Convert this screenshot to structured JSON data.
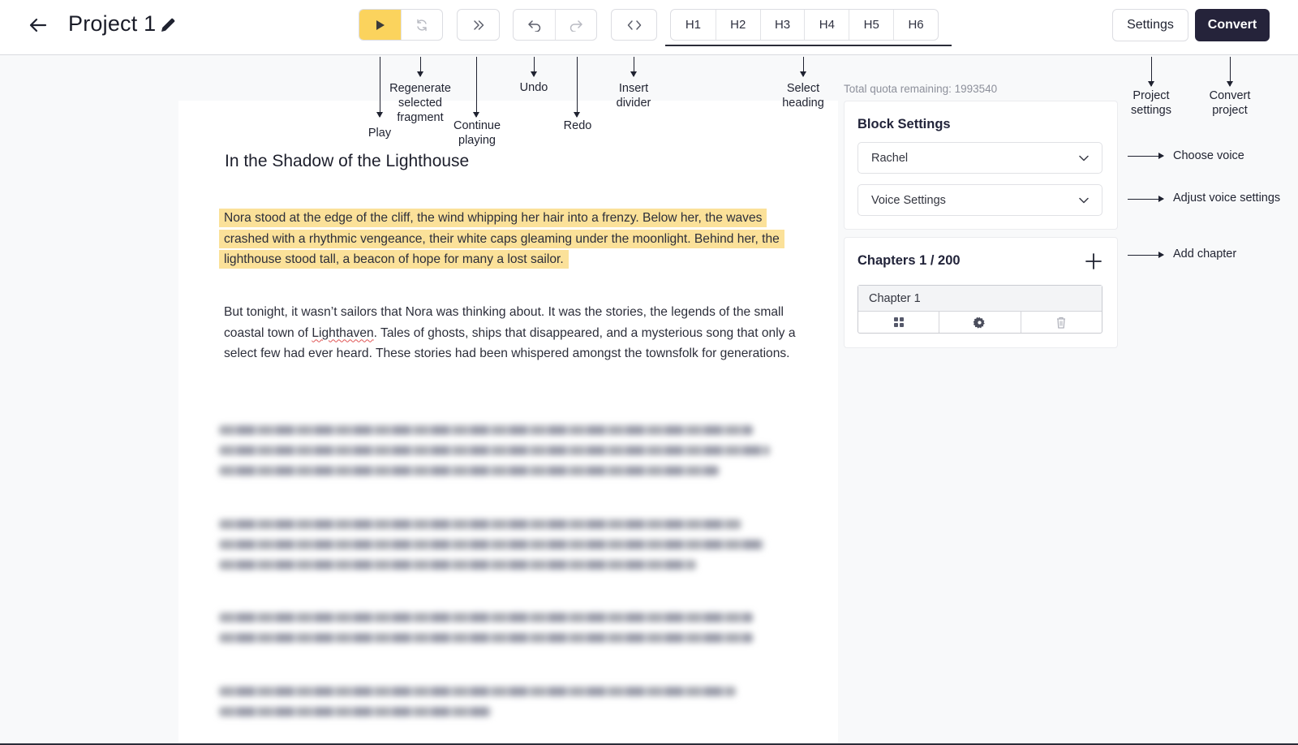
{
  "header": {
    "title": "Project 1",
    "settings_label": "Settings",
    "convert_label": "Convert",
    "headings": [
      "H1",
      "H2",
      "H3",
      "H4",
      "H5",
      "H6"
    ]
  },
  "annotations": {
    "play": "Play",
    "regenerate": "Regenerate selected fragment",
    "continue": "Continue playing",
    "undo": "Undo",
    "redo": "Redo",
    "insert_divider": "Insert divider",
    "select_heading": "Select heading",
    "project_settings": "Project settings",
    "convert_project": "Convert project",
    "choose_voice": "Choose voice",
    "adjust_voice": "Adjust voice settings",
    "add_chapter": "Add chapter"
  },
  "editor": {
    "title": "In the Shadow of the Lighthouse",
    "paragraph1": "Nora stood at the edge of the cliff, the wind whipping her hair into a frenzy. Below her, the waves crashed with a rhythmic vengeance, their white caps gleaming under the moonlight. Behind her, the lighthouse stood tall, a beacon of hope for many a lost sailor.",
    "paragraph2_a": "But tonight, it wasn’t sailors that Nora was thinking about. It was the stories, the legends of the small coastal town of ",
    "paragraph2_link": "Lighthaven",
    "paragraph2_b": ". Tales of ghosts, ships that disappeared, and a mysterious song that only a select few had ever heard. These stories had been whispered amongst the townsfolk for generations."
  },
  "sidebar": {
    "quota": "Total quota remaining: 1993540",
    "block_settings_title": "Block Settings",
    "voice_value": "Rachel",
    "voice_settings_label": "Voice Settings",
    "chapters_title": "Chapters 1 / 200",
    "chapter_name": "Chapter 1"
  },
  "colors": {
    "accent": "#fbd35d",
    "highlight": "#fbe199",
    "convert_bg": "#25233a"
  }
}
